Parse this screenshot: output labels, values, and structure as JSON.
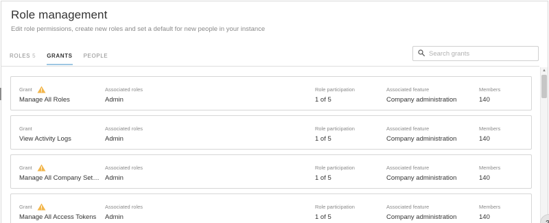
{
  "header": {
    "title": "Role management",
    "subtitle": "Edit role permissions, create new roles and set a default for new people in your instance"
  },
  "tabs": [
    {
      "label": "ROLES",
      "count": "5",
      "active": false
    },
    {
      "label": "GRANTS",
      "count": "",
      "active": true
    },
    {
      "label": "PEOPLE",
      "count": "",
      "active": false
    }
  ],
  "search": {
    "placeholder": "Search grants",
    "value": ""
  },
  "columns": {
    "grant": "Grant",
    "roles": "Associated roles",
    "participation": "Role participation",
    "feature": "Associated feature",
    "members": "Members"
  },
  "grants": [
    {
      "name": "Manage All Roles",
      "roles": "Admin",
      "participation": "1 of 5",
      "feature": "Company administration",
      "members": "140",
      "warning": true
    },
    {
      "name": "View Activity Logs",
      "roles": "Admin",
      "participation": "1 of 5",
      "feature": "Company administration",
      "members": "140",
      "warning": false
    },
    {
      "name": "Manage All Company Settings",
      "roles": "Admin",
      "participation": "1 of 5",
      "feature": "Company administration",
      "members": "140",
      "warning": true
    },
    {
      "name": "Manage All Access Tokens",
      "roles": "Admin",
      "participation": "1 of 5",
      "feature": "Company administration",
      "members": "140",
      "warning": true
    }
  ],
  "help": {
    "label": "?"
  },
  "colors": {
    "accent_underline": "#9ec7e3",
    "warning": "#f2b64c"
  },
  "icons": {
    "search": "search-icon",
    "warning": "warning-icon",
    "help": "help-icon"
  }
}
